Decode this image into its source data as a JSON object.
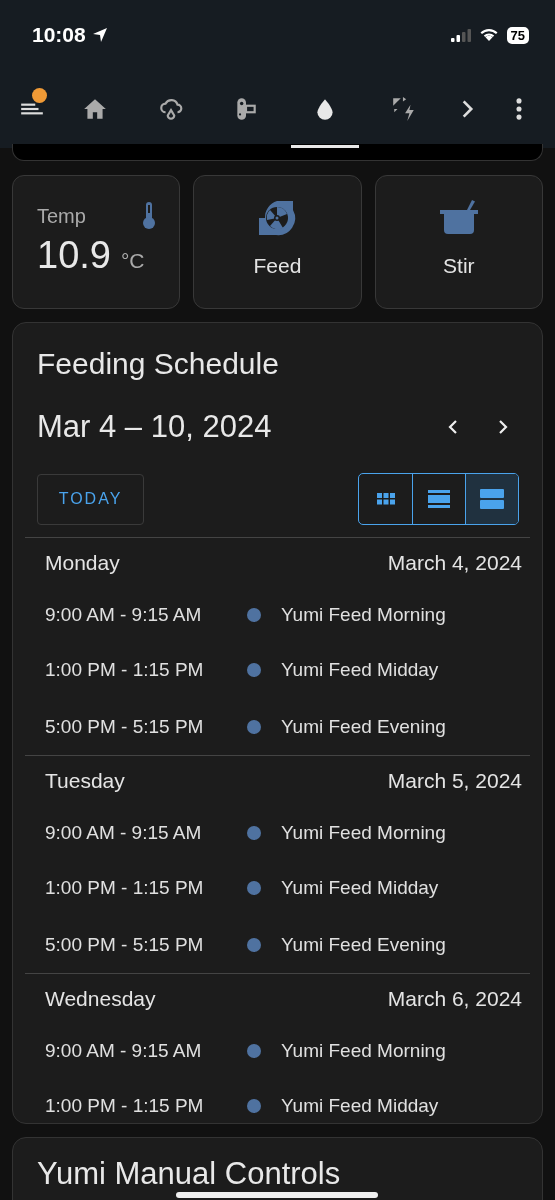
{
  "status_bar": {
    "time": "10:08",
    "battery": "75"
  },
  "nav": {
    "items": [
      {
        "kind": "menu",
        "selected": false,
        "badge": true
      },
      {
        "kind": "home",
        "selected": false
      },
      {
        "kind": "weather",
        "selected": false
      },
      {
        "kind": "remote",
        "selected": false
      },
      {
        "kind": "water",
        "selected": true
      },
      {
        "kind": "solar",
        "selected": false
      },
      {
        "kind": "next",
        "selected": false
      },
      {
        "kind": "more",
        "selected": false
      }
    ]
  },
  "tiles": [
    {
      "kind": "sensor",
      "label": "Temp",
      "value": "10.9",
      "unit": "°C"
    },
    {
      "kind": "button",
      "label": "Feed"
    },
    {
      "kind": "button",
      "label": "Stir"
    }
  ],
  "calendar": {
    "title": "Feeding Schedule",
    "range": "Mar 4 – 10, 2024",
    "today_button": "TODAY",
    "views": [
      {
        "kind": "month",
        "selected": false
      },
      {
        "kind": "week",
        "selected": false
      },
      {
        "kind": "list",
        "selected": true
      }
    ],
    "days": [
      {
        "name": "Monday",
        "date": "March 4, 2024",
        "events": [
          {
            "time": "9:00 AM - 9:15 AM",
            "title": "Yumi Feed Morning"
          },
          {
            "time": "1:00 PM - 1:15 PM",
            "title": "Yumi Feed Midday"
          },
          {
            "time": "5:00 PM - 5:15 PM",
            "title": "Yumi Feed Evening"
          }
        ]
      },
      {
        "name": "Tuesday",
        "date": "March 5, 2024",
        "events": [
          {
            "time": "9:00 AM - 9:15 AM",
            "title": "Yumi Feed Morning"
          },
          {
            "time": "1:00 PM - 1:15 PM",
            "title": "Yumi Feed Midday"
          },
          {
            "time": "5:00 PM - 5:15 PM",
            "title": "Yumi Feed Evening"
          }
        ]
      },
      {
        "name": "Wednesday",
        "date": "March 6, 2024",
        "events": [
          {
            "time": "9:00 AM - 9:15 AM",
            "title": "Yumi Feed Morning"
          },
          {
            "time": "1:00 PM - 1:15 PM",
            "title": "Yumi Feed Midday"
          }
        ]
      }
    ]
  },
  "controls_card": {
    "title": "Yumi Manual Controls"
  }
}
